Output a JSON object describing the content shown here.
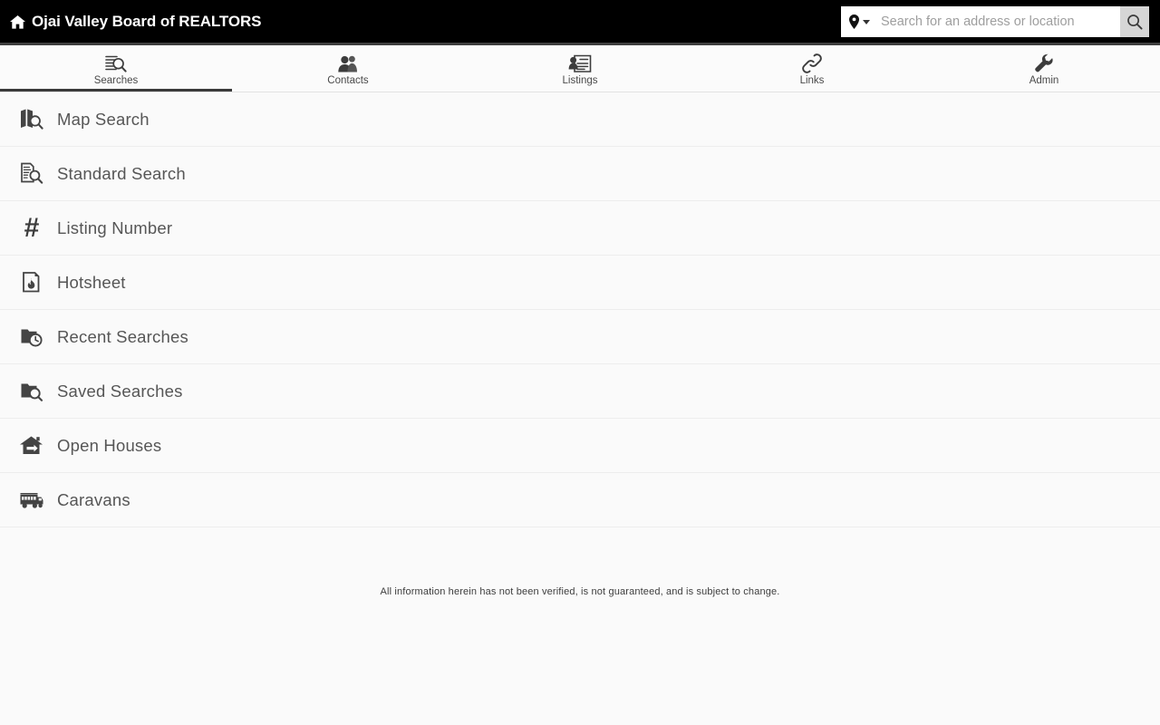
{
  "header": {
    "brand_title": "Ojai Valley Board of REALTORS",
    "brand_icon": "home-icon",
    "search": {
      "placeholder": "Search for an address or location",
      "value": "",
      "location_icon": "map-pin-icon",
      "dropdown_icon": "chevron-down-icon",
      "submit_icon": "search-icon"
    },
    "background_color": "#000000"
  },
  "tabs": {
    "active_index": 0,
    "items": [
      {
        "label": "Searches",
        "icon": "document-search-icon"
      },
      {
        "label": "Contacts",
        "icon": "people-icon"
      },
      {
        "label": "Listings",
        "icon": "listing-card-icon"
      },
      {
        "label": "Links",
        "icon": "chain-link-icon"
      },
      {
        "label": "Admin",
        "icon": "wrench-icon"
      }
    ],
    "active_underline_color": "#3a3a3a"
  },
  "menu": {
    "items": [
      {
        "label": "Map Search",
        "icon": "map-search-icon"
      },
      {
        "label": "Standard Search",
        "icon": "document-search-icon"
      },
      {
        "label": "Listing Number",
        "icon": "hash-icon"
      },
      {
        "label": "Hotsheet",
        "icon": "flame-document-icon"
      },
      {
        "label": "Recent Searches",
        "icon": "folder-clock-icon"
      },
      {
        "label": "Saved Searches",
        "icon": "folder-search-icon"
      },
      {
        "label": "Open Houses",
        "icon": "open-house-icon"
      },
      {
        "label": "Caravans",
        "icon": "bus-icon"
      }
    ]
  },
  "footer": {
    "disclaimer": "All information herein has not been verified, is not guaranteed, and is subject to change."
  }
}
